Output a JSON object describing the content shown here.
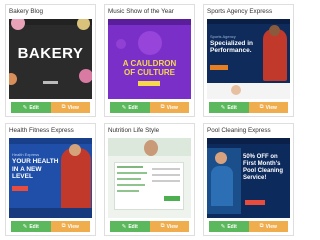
{
  "cards": [
    {
      "title": "Bakery Blog",
      "edit_label": "Edit",
      "view_label": "View",
      "preview": {
        "headline": "BAKERY",
        "bg": "#2b2b2b"
      }
    },
    {
      "title": "Music Show of the Year",
      "edit_label": "Edit",
      "view_label": "View",
      "preview": {
        "headline": "A CAULDRON OF CULTURE",
        "bg": "#7b2fc9"
      }
    },
    {
      "title": "Sports Agency Express",
      "edit_label": "Edit",
      "view_label": "View",
      "preview": {
        "kicker": "Sports Agency",
        "headline": "Specialized in Performance.",
        "bg": "#0f2b5b"
      }
    },
    {
      "title": "Health Fitness Express",
      "edit_label": "Edit",
      "view_label": "View",
      "preview": {
        "kicker": "Health Express",
        "headline": "YOUR HEALTH IN A NEW LEVEL",
        "bg": "#1f4fa8"
      }
    },
    {
      "title": "Nutrition Life Style",
      "edit_label": "Edit",
      "view_label": "View",
      "preview": {
        "bg": "#eef3ee"
      }
    },
    {
      "title": "Pool Cleaning Express",
      "edit_label": "Edit",
      "view_label": "View",
      "preview": {
        "headline": "50% OFF on First Month's Pool Cleaning Service!",
        "bg": "#0d2a5c"
      }
    }
  ],
  "colors": {
    "edit": "#5cb85c",
    "view": "#f0ad4e"
  }
}
